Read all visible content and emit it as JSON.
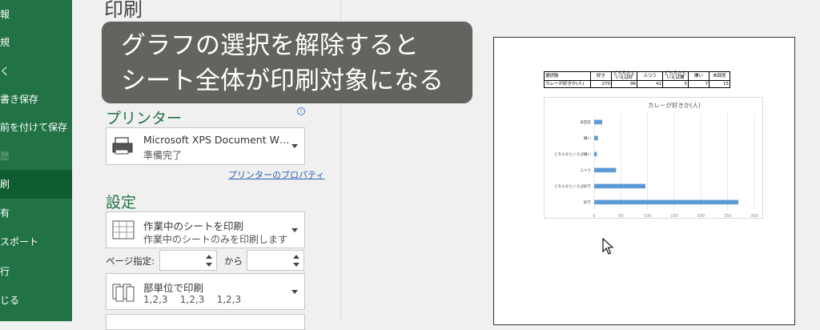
{
  "nav": {
    "items": [
      {
        "label": "報",
        "state": "normal"
      },
      {
        "label": "規",
        "state": "normal"
      },
      {
        "label": "く",
        "state": "normal"
      },
      {
        "label": "書き保存",
        "state": "normal"
      },
      {
        "label": "前を付けて保存",
        "state": "normal"
      },
      {
        "label": "歴",
        "state": "disabled"
      },
      {
        "label": "刷",
        "state": "selected"
      },
      {
        "label": "有",
        "state": "normal"
      },
      {
        "label": "スポート",
        "state": "normal"
      },
      {
        "label": "行",
        "state": "normal"
      },
      {
        "label": "じる",
        "state": "normal"
      }
    ]
  },
  "panel": {
    "title": "印刷",
    "printer_section": "プリンター",
    "printer_name": "Microsoft XPS Document W…",
    "printer_status": "準備完了",
    "printer_properties_link": "プリンターのプロパティ",
    "settings_section": "設定",
    "scope_main": "作業中のシートを印刷",
    "scope_sub": "作業中のシートのみを印刷します",
    "page_range_label": "ページ指定:",
    "from_label": "から",
    "collate_main": "部単位で印刷",
    "collate_sub": "1,2,3    1,2,3    1,2,3"
  },
  "caption": {
    "line1": "グラフの選択を解除すると",
    "line2": "シート全体が印刷対象になる"
  },
  "preview": {
    "table": {
      "headers": [
        "選択肢",
        "好き",
        "どちらかと\nいえば好",
        "ふつう",
        "どちらかと\nいえば嫌",
        "嫌い",
        "未回答"
      ],
      "row_label": "カレーが好きか(人)",
      "values": [
        "270",
        "96",
        "41",
        "5",
        "7",
        "15"
      ]
    }
  },
  "chart_data": {
    "type": "bar",
    "orientation": "horizontal",
    "title": "カレーが好きか(人)",
    "categories": [
      "未回答",
      "嫌い",
      "どちらかといえば嫌い",
      "ふつう",
      "どちらかといえば好き",
      "好き"
    ],
    "values": [
      15,
      7,
      5,
      41,
      96,
      270
    ],
    "xlim": [
      0,
      300
    ],
    "xticks": [
      "0",
      "50",
      "100",
      "150",
      "200",
      "250",
      "300"
    ],
    "grid": true,
    "bar_color": "#5b9bd5"
  },
  "colors": {
    "nav_bg": "#217346",
    "accent_green": "#217346",
    "link_blue": "#2b5fb4"
  }
}
